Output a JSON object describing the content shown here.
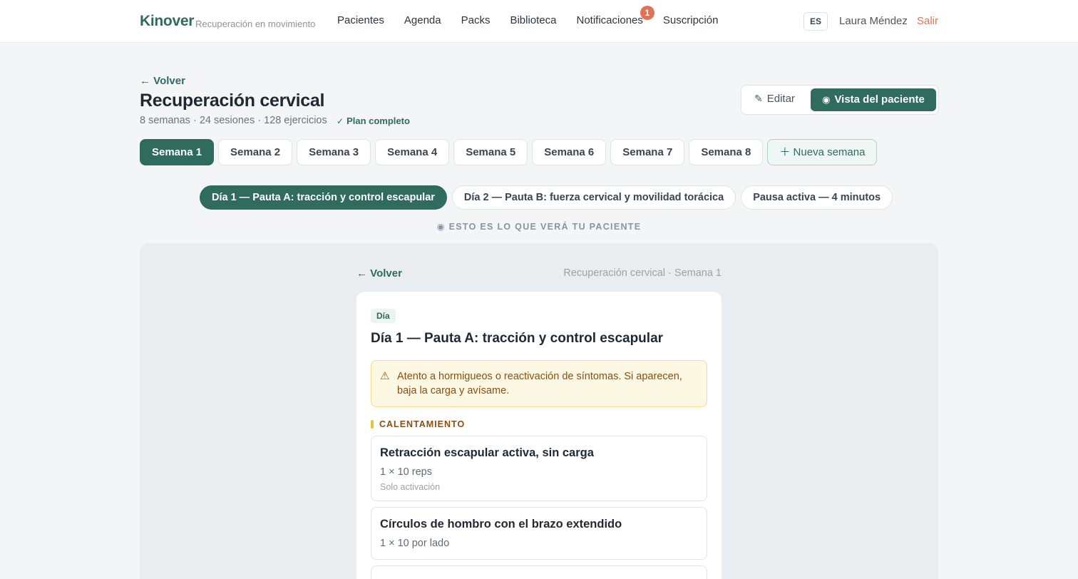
{
  "app": {
    "brand": "Kinover",
    "tagline": "Recuperación en movimiento",
    "accent_color": "#2f6b5e"
  },
  "nav": {
    "items": [
      "Pacientes",
      "Agenda",
      "Packs",
      "Biblioteca",
      "Notificaciones",
      "Suscripción"
    ],
    "notifications_badge": "1"
  },
  "user": {
    "lang": "ES",
    "name": "Laura Méndez",
    "logout": "Salir"
  },
  "header": {
    "back": "Volver",
    "title": "Recuperación cervical",
    "meta": "8 semanas · 24 sesiones · 128 ejercicios",
    "status": "Plan completo",
    "edit_label": "Editar",
    "view_label": "Vista del paciente"
  },
  "weeks": {
    "items": [
      "Semana 1",
      "Semana 2",
      "Semana 3",
      "Semana 4",
      "Semana 5",
      "Semana 6",
      "Semana 7",
      "Semana 8"
    ],
    "active_index": 0,
    "new_label": "Nueva semana"
  },
  "days": {
    "items": [
      "Día 1 — Pauta A: tracción y control escapular",
      "Día 2 — Pauta B: fuerza cervical y movilidad torácica",
      "Pausa activa — 4 minutos"
    ],
    "active_index": 0
  },
  "preview_note": "ESTO ES LO QUE VERÁ TU PACIENTE",
  "preview": {
    "back": "Volver",
    "breadcrumb": "Recuperación cervical · Semana 1",
    "tag": "Día",
    "title": "Día 1 — Pauta A: tracción y control escapular",
    "warning": "Atento a hormigueos o reactivación de síntomas. Si aparecen, baja la carga y avísame.",
    "section": "CALENTAMIENTO",
    "exercises": [
      {
        "name": "Retracción escapular activa, sin carga",
        "dose": "1 × 10 reps",
        "note": "Solo activación"
      },
      {
        "name": "Círculos de hombro con el brazo extendido",
        "dose": "1 × 10 por lado",
        "note": ""
      }
    ]
  }
}
